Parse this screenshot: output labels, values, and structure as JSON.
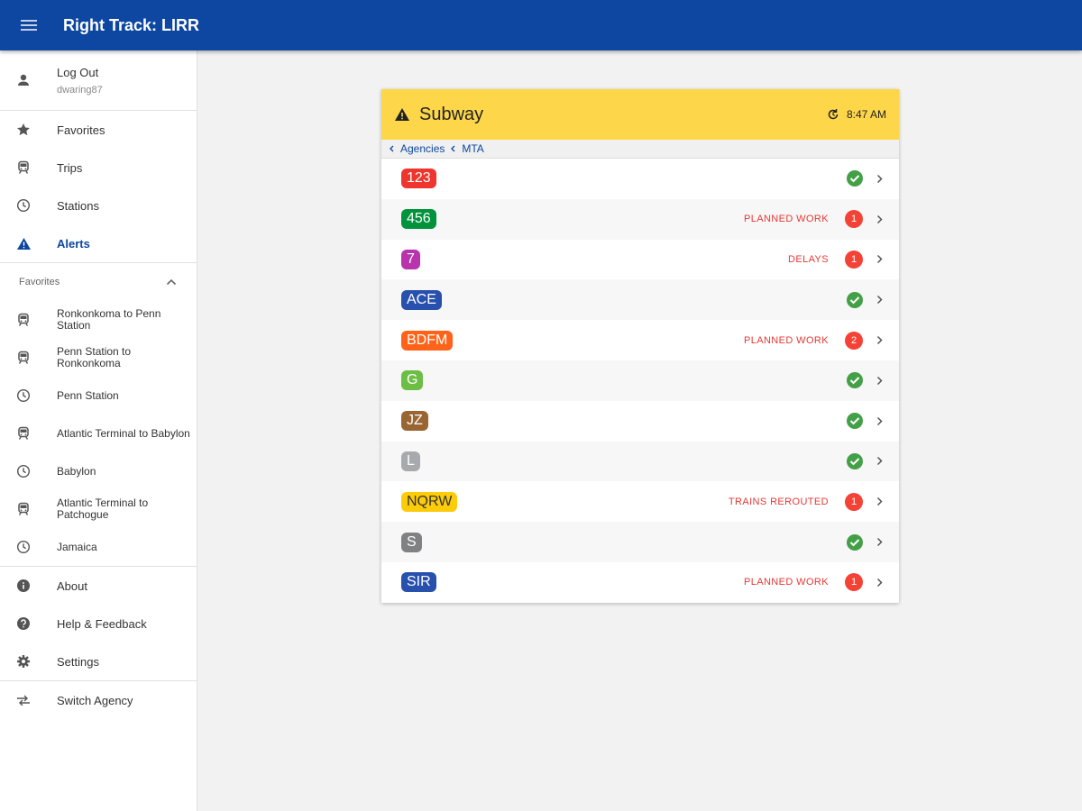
{
  "app": {
    "title": "Right Track: LIRR"
  },
  "drawer": {
    "user": {
      "label": "Log Out",
      "username": "dwaring87"
    },
    "nav": [
      {
        "label": "Favorites",
        "icon": "star-icon",
        "active": false
      },
      {
        "label": "Trips",
        "icon": "train-icon",
        "active": false
      },
      {
        "label": "Stations",
        "icon": "clock-icon",
        "active": false
      },
      {
        "label": "Alerts",
        "icon": "warning-icon",
        "active": true
      }
    ],
    "favorites_header": "Favorites",
    "favorites": [
      {
        "label": "Ronkonkoma to Penn Station",
        "icon": "train-icon"
      },
      {
        "label": "Penn Station to Ronkonkoma",
        "icon": "train-icon"
      },
      {
        "label": "Penn Station",
        "icon": "clock-icon"
      },
      {
        "label": "Atlantic Terminal to Babylon",
        "icon": "train-icon"
      },
      {
        "label": "Babylon",
        "icon": "clock-icon"
      },
      {
        "label": "Atlantic Terminal to Patchogue",
        "icon": "train-icon"
      },
      {
        "label": "Jamaica",
        "icon": "clock-icon"
      }
    ],
    "footer": [
      {
        "label": "About",
        "icon": "info-icon"
      },
      {
        "label": "Help & Feedback",
        "icon": "help-icon"
      },
      {
        "label": "Settings",
        "icon": "gear-icon"
      }
    ],
    "switch_agency": {
      "label": "Switch Agency",
      "icon": "swap-icon"
    }
  },
  "card": {
    "title": "Subway",
    "time": "8:47 AM",
    "breadcrumbs": [
      "Agencies",
      "MTA"
    ],
    "lines": [
      {
        "name": "123",
        "color": "#ee352e",
        "text_color": "#ffffff",
        "status": "",
        "count": null
      },
      {
        "name": "456",
        "color": "#00933c",
        "text_color": "#ffffff",
        "status": "PLANNED WORK",
        "count": 1
      },
      {
        "name": "7",
        "color": "#b933ad",
        "text_color": "#ffffff",
        "status": "DELAYS",
        "count": 1
      },
      {
        "name": "ACE",
        "color": "#2850ad",
        "text_color": "#ffffff",
        "status": "",
        "count": null
      },
      {
        "name": "BDFM",
        "color": "#ff6319",
        "text_color": "#ffffff",
        "status": "PLANNED WORK",
        "count": 2
      },
      {
        "name": "G",
        "color": "#6cbe45",
        "text_color": "#ffffff",
        "status": "",
        "count": null
      },
      {
        "name": "JZ",
        "color": "#996633",
        "text_color": "#ffffff",
        "status": "",
        "count": null
      },
      {
        "name": "L",
        "color": "#a7a9ac",
        "text_color": "#ffffff",
        "status": "",
        "count": null
      },
      {
        "name": "NQRW",
        "color": "#fccc0a",
        "text_color": "#333333",
        "status": "TRAINS REROUTED",
        "count": 1
      },
      {
        "name": "S",
        "color": "#808183",
        "text_color": "#ffffff",
        "status": "",
        "count": null
      },
      {
        "name": "SIR",
        "color": "#2850ad",
        "text_color": "#ffffff",
        "status": "PLANNED WORK",
        "count": 1
      }
    ]
  }
}
